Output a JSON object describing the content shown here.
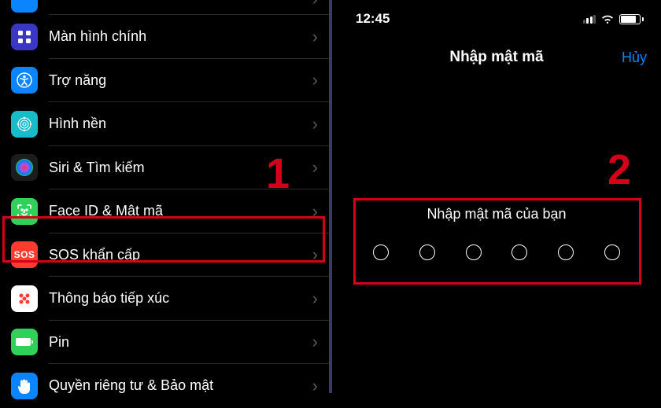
{
  "settings": {
    "items": [
      {
        "label": "",
        "icon": "brightness",
        "bg": "#0a84ff"
      },
      {
        "label": "Màn hình chính",
        "icon": "home",
        "bg": "#3a36c7"
      },
      {
        "label": "Trợ năng",
        "icon": "accessibility",
        "bg": "#0a84ff"
      },
      {
        "label": "Hình nền",
        "icon": "wallpaper",
        "bg": "#18bcc9"
      },
      {
        "label": "Siri & Tìm kiếm",
        "icon": "siri",
        "bg": "#1c1c1e"
      },
      {
        "label": "Face ID & Mật mã",
        "icon": "faceid",
        "bg": "#30d158"
      },
      {
        "label": "SOS khẩn cấp",
        "icon": "sos",
        "bg": "#ff3b30"
      },
      {
        "label": "Thông báo tiếp xúc",
        "icon": "exposure",
        "bg": "#ffffff"
      },
      {
        "label": "Pin",
        "icon": "battery",
        "bg": "#30d158"
      },
      {
        "label": "Quyền riêng tư & Bảo mật",
        "icon": "privacy",
        "bg": "#0a84ff"
      }
    ]
  },
  "annotations": {
    "step1": "1",
    "step2": "2"
  },
  "statusbar": {
    "time": "12:45",
    "battery_pct": "76"
  },
  "passcode": {
    "nav_title": "Nhập mật mã",
    "cancel": "Hủy",
    "prompt": "Nhập mật mã của bạn",
    "dot_count": 6
  }
}
